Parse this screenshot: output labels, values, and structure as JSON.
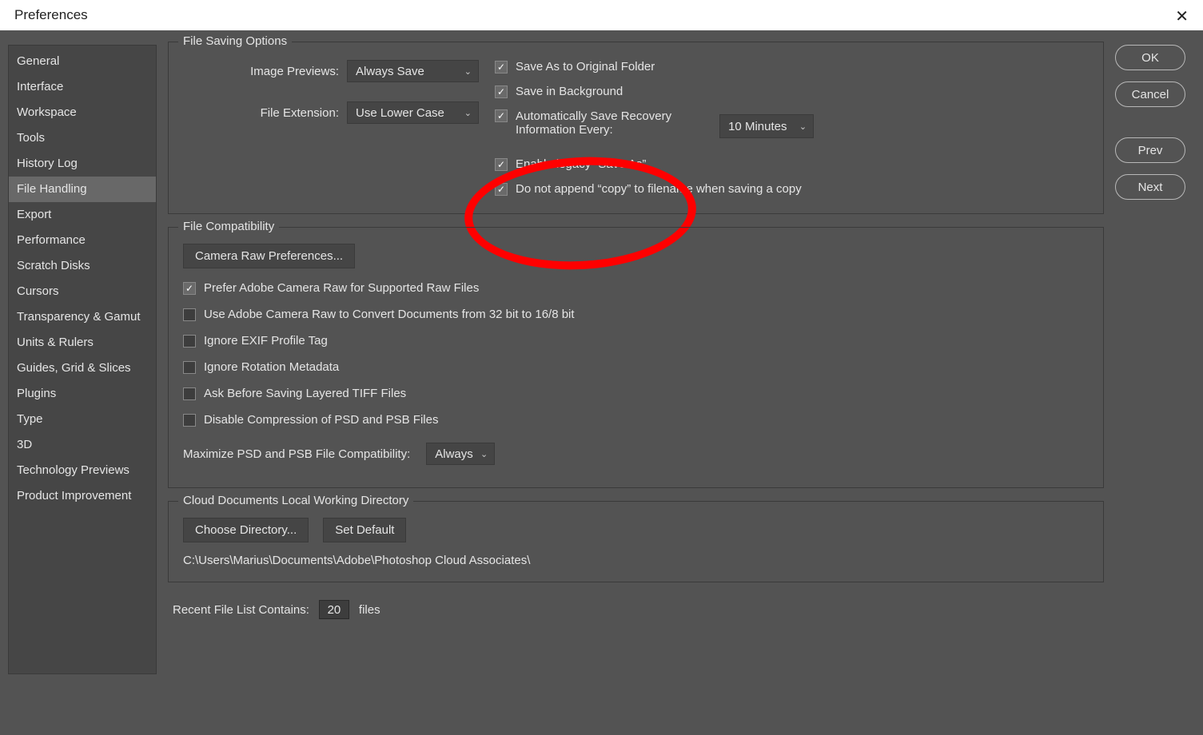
{
  "title": "Preferences",
  "sidebar": {
    "items": [
      "General",
      "Interface",
      "Workspace",
      "Tools",
      "History Log",
      "File Handling",
      "Export",
      "Performance",
      "Scratch Disks",
      "Cursors",
      "Transparency & Gamut",
      "Units & Rulers",
      "Guides, Grid & Slices",
      "Plugins",
      "Type",
      "3D",
      "Technology Previews",
      "Product Improvement"
    ],
    "selected": "File Handling"
  },
  "buttons": {
    "ok": "OK",
    "cancel": "Cancel",
    "prev": "Prev",
    "next": "Next"
  },
  "fileSaving": {
    "legend": "File Saving Options",
    "imagePreviewsLabel": "Image Previews:",
    "imagePreviewsValue": "Always Save",
    "fileExtLabel": "File Extension:",
    "fileExtValue": "Use Lower Case",
    "cb_saveAsOriginal": "Save As to Original Folder",
    "cb_saveBg": "Save in Background",
    "cb_autoRecoverL1": "Automatically Save Recovery",
    "cb_autoRecoverL2": "Information Every:",
    "autoRecoverValue": "10 Minutes",
    "cb_legacy": "Enable legacy “Save As”",
    "cb_noCopy": "Do not append “copy” to filename when saving a copy"
  },
  "fileCompat": {
    "legend": "File Compatibility",
    "cameraRawBtn": "Camera Raw Preferences...",
    "cb_preferACR": "Prefer Adobe Camera Raw for Supported Raw Files",
    "cb_useACR32": "Use Adobe Camera Raw to Convert Documents from 32 bit to 16/8 bit",
    "cb_ignoreExif": "Ignore EXIF Profile Tag",
    "cb_ignoreRot": "Ignore Rotation Metadata",
    "cb_askTiff": "Ask Before Saving Layered TIFF Files",
    "cb_disableComp": "Disable Compression of PSD and PSB Files",
    "maxCompatLabel": "Maximize PSD and PSB File Compatibility:",
    "maxCompatValue": "Always"
  },
  "cloud": {
    "legend": "Cloud Documents Local Working Directory",
    "chooseBtn": "Choose Directory...",
    "defaultBtn": "Set Default",
    "path": "C:\\Users\\Marius\\Documents\\Adobe\\Photoshop Cloud Associates\\"
  },
  "recent": {
    "label": "Recent File List Contains:",
    "value": "20",
    "suffix": "files"
  }
}
